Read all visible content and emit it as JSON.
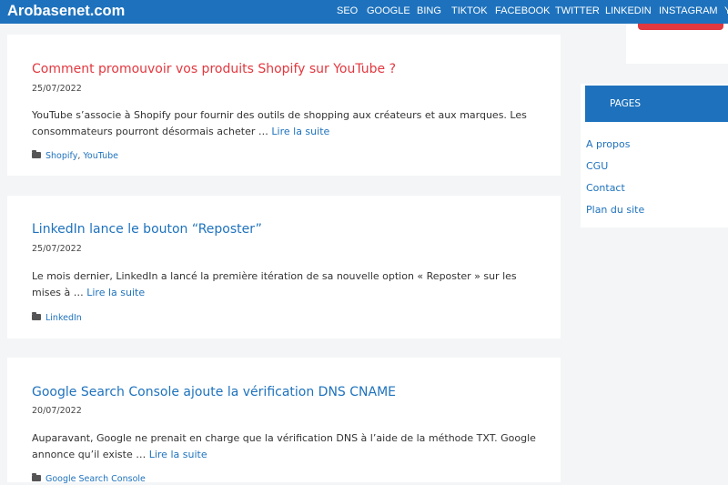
{
  "header": {
    "brand": "Arobasenet.com",
    "nav": [
      "SEO",
      "GOOGLE",
      "BING",
      "TIKTOK",
      "FACEBOOK",
      "TWITTER",
      "LINKEDIN",
      "INSTAGRAM",
      "Y"
    ]
  },
  "articles": [
    {
      "title": "Comment promouvoir vos produits Shopify sur YouTube ?",
      "date": "25/07/2022",
      "excerpt": "YouTube s’associe à Shopify pour fournir des outils de shopping aux créateurs et aux marques. Les consommateurs pourront désormais acheter …",
      "read_more": "Lire la suite",
      "categories": [
        "Shopify",
        "YouTube"
      ]
    },
    {
      "title": "LinkedIn lance le bouton “Reposter”",
      "date": "25/07/2022",
      "excerpt": "Le mois dernier, LinkedIn a lancé la première itération de sa nouvelle option « Reposter » sur les mises à …",
      "read_more": "Lire la suite",
      "categories": [
        "LinkedIn"
      ]
    },
    {
      "title": "Google Search Console ajoute la vérification DNS CNAME",
      "date": "20/07/2022",
      "excerpt": "Auparavant, Google ne prenait en charge que la vérification DNS à l’aide de la méthode TXT. Google annonce qu’il existe …",
      "read_more": "Lire la suite",
      "categories": [
        "Google Search Console"
      ]
    }
  ],
  "sidebar": {
    "pages_title": "PAGES",
    "pages": [
      "A propos",
      "CGU",
      "Contact",
      "Plan du site"
    ]
  },
  "colors": {
    "brand_blue": "#1e72bd",
    "first_title_red": "#e2383f",
    "background": "#f4f5f6"
  }
}
